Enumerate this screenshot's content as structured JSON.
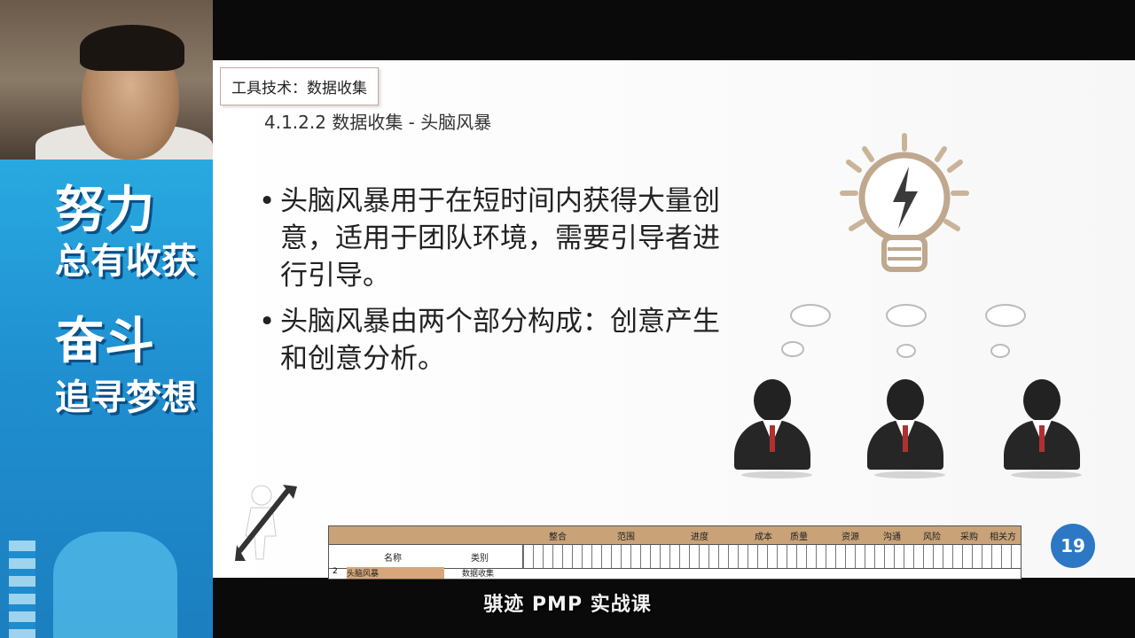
{
  "poster": {
    "line1": "努力",
    "line2": "总有收获",
    "line3": "奋斗",
    "line4": "追寻梦想"
  },
  "slide": {
    "tool_tag": "工具技术：数据收集",
    "subtitle": "4.1.2.2 数据收集 - 头脑风暴",
    "bullets": [
      "头脑风暴用于在短时间内获得大量创意，适用于团队环境，需要引导者进行引导。",
      "头脑风暴由两个部分构成：创意产生和创意分析。"
    ],
    "page_number": "19"
  },
  "sheet": {
    "groups": [
      "整合",
      "范围",
      "进度",
      "成本",
      "质量",
      "资源",
      "沟通",
      "风险",
      "采购",
      "相关方"
    ],
    "col_name": "名称",
    "col_category": "类别",
    "row": {
      "index": "2",
      "name": "头脑风暴",
      "category": "数据收集"
    }
  },
  "caption": "骐迹 PMP 实战课",
  "colors": {
    "badge": "#2d78c4",
    "poster_blue": "#1f8fd0",
    "sheet_header": "#c9a278"
  }
}
